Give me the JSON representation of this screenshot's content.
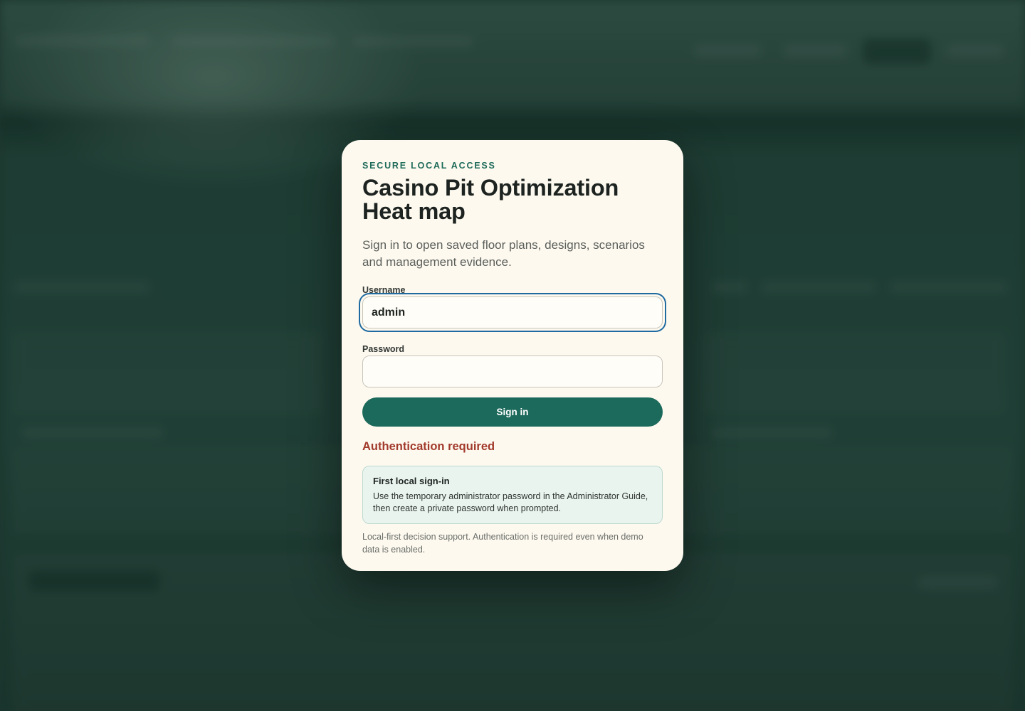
{
  "login": {
    "eyebrow": "SECURE LOCAL ACCESS",
    "title": "Casino Pit Optimization Heat map",
    "subtitle": "Sign in to open saved floor plans, designs, scenarios and management evidence.",
    "username_label": "Username",
    "username_value": "admin",
    "password_label": "Password",
    "password_value": "",
    "sign_in_label": "Sign in",
    "error_text": "Authentication required",
    "notice": {
      "title": "First local sign-in",
      "body": "Use the temporary administrator password in the Administrator Guide, then create a private password when prompted."
    },
    "footnote": "Local-first decision support. Authentication is required even when demo data is enabled."
  },
  "colors": {
    "accent": "#1c6a5b",
    "error": "#a23a2c",
    "focus_ring": "#1f6aa0",
    "card_bg": "#fdf9ef"
  }
}
